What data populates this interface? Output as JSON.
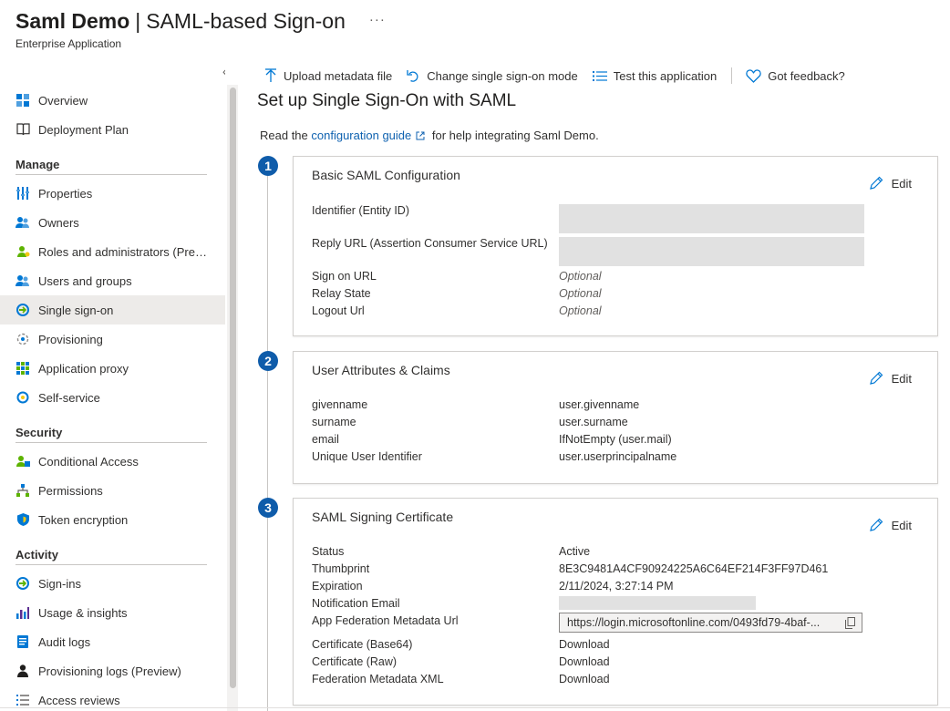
{
  "header": {
    "app_name": "Saml Demo",
    "separator": "|",
    "page_name": "SAML-based Sign-on",
    "more": "···",
    "subtitle": "Enterprise Application"
  },
  "sidebar": {
    "collapse": "«",
    "top": [
      {
        "label": "Overview",
        "icon": "overview-icon"
      },
      {
        "label": "Deployment Plan",
        "icon": "book-icon"
      }
    ],
    "sections": [
      {
        "title": "Manage",
        "items": [
          {
            "label": "Properties",
            "icon": "properties-icon"
          },
          {
            "label": "Owners",
            "icon": "owners-icon"
          },
          {
            "label": "Roles and administrators (Preview)",
            "icon": "roles-icon"
          },
          {
            "label": "Users and groups",
            "icon": "users-icon"
          },
          {
            "label": "Single sign-on",
            "icon": "sso-icon",
            "selected": true
          },
          {
            "label": "Provisioning",
            "icon": "provisioning-icon"
          },
          {
            "label": "Application proxy",
            "icon": "app-proxy-icon"
          },
          {
            "label": "Self-service",
            "icon": "self-service-icon"
          }
        ]
      },
      {
        "title": "Security",
        "items": [
          {
            "label": "Conditional Access",
            "icon": "conditional-access-icon"
          },
          {
            "label": "Permissions",
            "icon": "permissions-icon"
          },
          {
            "label": "Token encryption",
            "icon": "shield-icon"
          }
        ]
      },
      {
        "title": "Activity",
        "items": [
          {
            "label": "Sign-ins",
            "icon": "sign-ins-icon"
          },
          {
            "label": "Usage & insights",
            "icon": "usage-icon"
          },
          {
            "label": "Audit logs",
            "icon": "audit-icon"
          },
          {
            "label": "Provisioning logs (Preview)",
            "icon": "person-icon"
          },
          {
            "label": "Access reviews",
            "icon": "list-icon"
          }
        ]
      }
    ]
  },
  "toolbar": {
    "upload": "Upload metadata file",
    "change_mode": "Change single sign-on mode",
    "test": "Test this application",
    "feedback": "Got feedback?"
  },
  "main": {
    "title": "Set up Single Sign-On with SAML",
    "intro_pre": "Read the",
    "intro_link": "configuration guide",
    "intro_post": "for help integrating Saml Demo.",
    "edit_label": "Edit",
    "cards": [
      {
        "step": "1",
        "title": "Basic SAML Configuration",
        "rows": [
          {
            "label": "Identifier (Entity ID)",
            "value": ""
          },
          {
            "label": "Reply URL (Assertion Consumer Service URL)",
            "value": ""
          },
          {
            "label": "Sign on URL",
            "value": "Optional"
          },
          {
            "label": "Relay State",
            "value": "Optional"
          },
          {
            "label": "Logout Url",
            "value": "Optional"
          }
        ]
      },
      {
        "step": "2",
        "title": "User Attributes & Claims",
        "rows": [
          {
            "label": "givenname",
            "value": "user.givenname"
          },
          {
            "label": "surname",
            "value": "user.surname"
          },
          {
            "label": "email",
            "value": "IfNotEmpty (user.mail)"
          },
          {
            "label": "Unique User Identifier",
            "value": "user.userprincipalname"
          }
        ]
      },
      {
        "step": "3",
        "title": "SAML Signing Certificate",
        "rows": [
          {
            "label": "Status",
            "value": "Active"
          },
          {
            "label": "Thumbprint",
            "value": "8E3C9481A4CF90924225A6C64EF214F3FF97D461"
          },
          {
            "label": "Expiration",
            "value": "2/11/2024, 3:27:14 PM"
          },
          {
            "label": "Notification Email",
            "value": ""
          },
          {
            "label": "App Federation Metadata Url",
            "value": "https://login.microsoftonline.com/0493fd79-4baf-..."
          },
          {
            "label": "Certificate (Base64)",
            "value": "Download"
          },
          {
            "label": "Certificate (Raw)",
            "value": "Download"
          },
          {
            "label": "Federation Metadata XML",
            "value": "Download"
          }
        ]
      }
    ]
  },
  "colors": {
    "accent": "#0f5caa",
    "link": "#0f62b0",
    "selected_bg": "#edebe9"
  }
}
